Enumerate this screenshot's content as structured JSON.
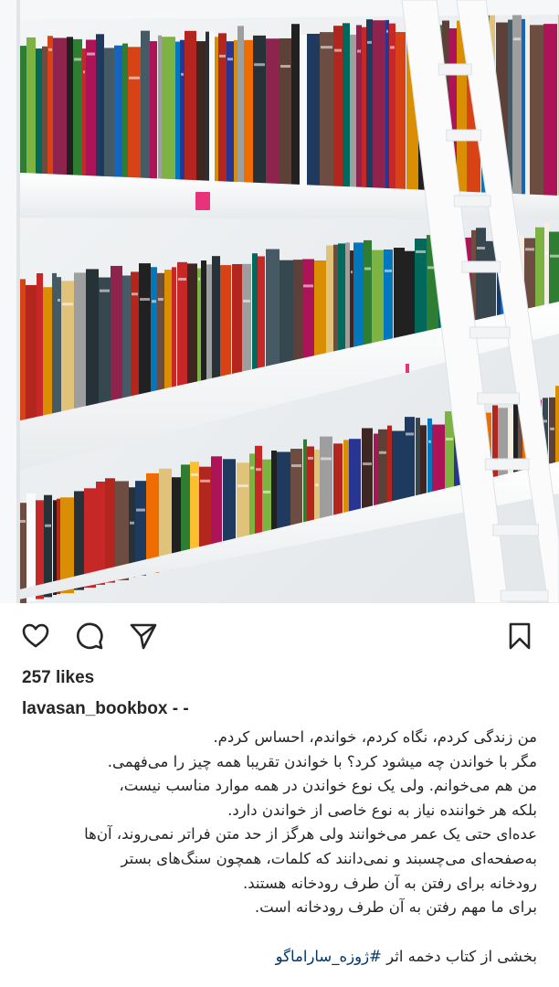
{
  "post": {
    "likes_text": "257 likes",
    "username": "lavasan_bookbox",
    "dash_text": "- -",
    "caption_lines": [
      "من زندگی کردم، نگاه کردم، خواندم، احساس کردم.",
      "مگر با خواندن چه میشود کرد؟ با خواندن تقریبا همه چیز را می‌فهمی.",
      "من هم می‌خوانم. ولی یک نوع خواندن در همه موارد مناسب نیست،",
      "بلکه هر خواننده نیاز به نوع خاصی از خواندن دارد.",
      "عده‌ای حتی یک عمر می‌خوانند ولی هرگز از حد متن فراتر نمی‌روند، آن‌ها",
      "به‌صفحه‌ای می‌چسبند و نمی‌دانند که کلمات، همچون سنگ‌های بستر",
      "رودخانه برای رفتن به آن طرف رودخانه هستند.",
      "برای ما مهم رفتن به آن طرف رودخانه است."
    ],
    "source_prefix": "بخشی از کتاب دخمه اثر ",
    "hashtag": "#ژوزه_ساراماگو"
  },
  "icons": {
    "like": "heart-icon",
    "comment": "comment-bubble-icon",
    "share": "paper-plane-icon",
    "save": "bookmark-icon"
  },
  "colors": {
    "text": "#262626",
    "hashtag": "#00376b",
    "shelf": "#f4f6f7"
  }
}
